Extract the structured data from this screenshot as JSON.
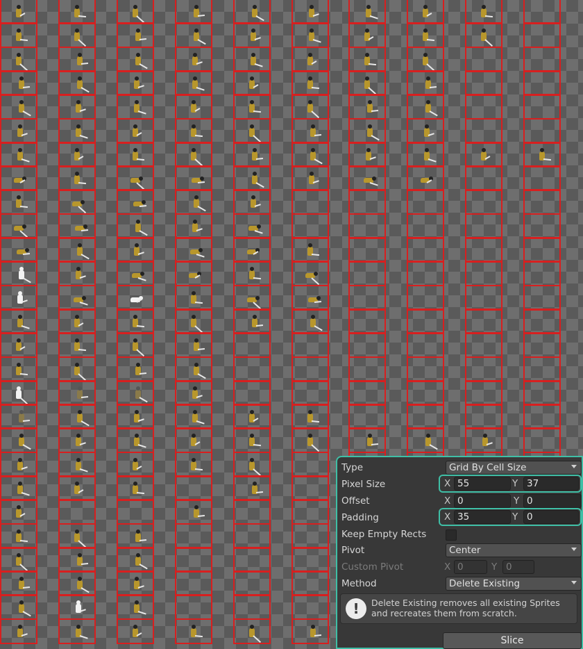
{
  "slicer": {
    "type": {
      "label": "Type",
      "value": "Grid By Cell Size"
    },
    "pixel_size": {
      "label": "Pixel Size",
      "x_label": "X",
      "x": "55",
      "y_label": "Y",
      "y": "37"
    },
    "offset": {
      "label": "Offset",
      "x_label": "X",
      "x": "0",
      "y_label": "Y",
      "y": "0"
    },
    "padding": {
      "label": "Padding",
      "x_label": "X",
      "x": "35",
      "y_label": "Y",
      "y": "0"
    },
    "keep_empty": {
      "label": "Keep Empty Rects",
      "checked": false
    },
    "pivot": {
      "label": "Pivot",
      "value": "Center"
    },
    "custom_pivot": {
      "label": "Custom Pivot",
      "x_label": "X",
      "x": "0",
      "y_label": "Y",
      "y": "0"
    },
    "method": {
      "label": "Method",
      "value": "Delete Existing"
    },
    "help_text": "Delete Existing removes all existing Sprites and recreates them from scratch.",
    "help_icon": "info-icon",
    "slice_label": "Slice"
  },
  "colors": {
    "slice_outline": "#d81f1f",
    "panel_highlight": "#3fbfa6",
    "panel_background": "#383838",
    "sprite_gold": "#b8972c"
  }
}
